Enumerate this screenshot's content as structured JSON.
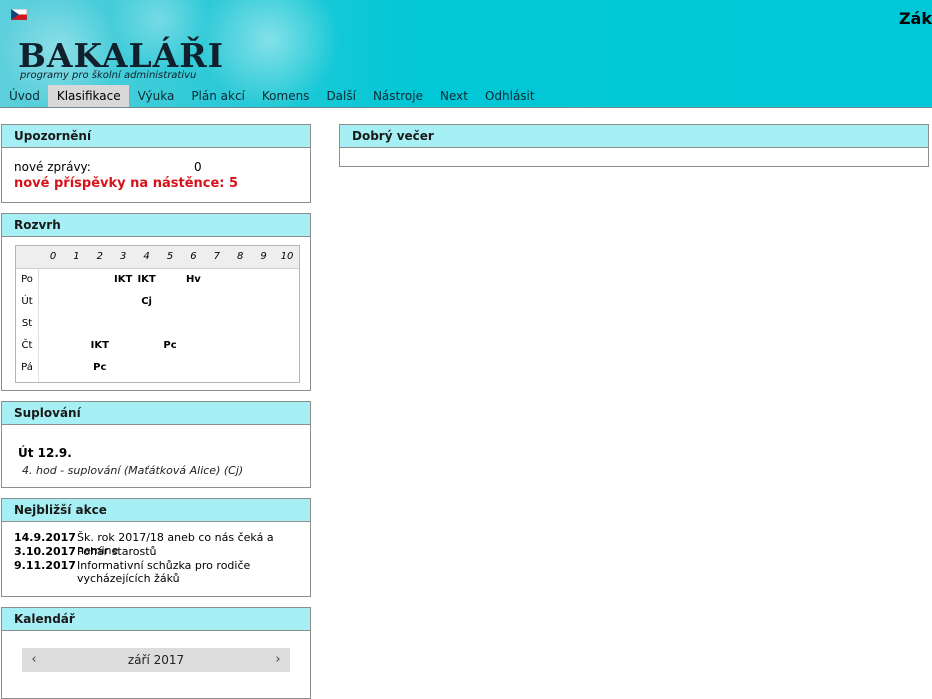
{
  "header": {
    "logo": "BAKALÁŘI",
    "tagline": "programy pro školní administrativu",
    "user_name": "Zák"
  },
  "menu": [
    "Úvod",
    "Klasifikace",
    "Výuka",
    "Plán akcí",
    "Komens",
    "Další",
    "Nástroje",
    "Next",
    "Odhlásit"
  ],
  "alerts": {
    "title": "Upozornění",
    "new_messages_label": "nové zprávy:",
    "new_messages_count": "0",
    "board_label": "nové příspěvky na nástěnce:",
    "board_count": "5"
  },
  "timetable": {
    "title": "Rozvrh",
    "hours": [
      "0",
      "1",
      "2",
      "3",
      "4",
      "5",
      "6",
      "7",
      "8",
      "9",
      "10"
    ],
    "days": [
      {
        "name": "Po",
        "lessons": [
          {
            "hour": 3,
            "subject": "IKT"
          },
          {
            "hour": 4,
            "subject": "IKT"
          },
          {
            "hour": 6,
            "subject": "Hv"
          }
        ]
      },
      {
        "name": "Út",
        "lessons": [
          {
            "hour": 4,
            "subject": "Cj"
          }
        ]
      },
      {
        "name": "St",
        "lessons": []
      },
      {
        "name": "Čt",
        "lessons": [
          {
            "hour": 2,
            "subject": "IKT"
          },
          {
            "hour": 5,
            "subject": "Pc"
          }
        ]
      },
      {
        "name": "Pá",
        "lessons": [
          {
            "hour": 2,
            "subject": "Pc"
          }
        ]
      }
    ]
  },
  "substitutions": {
    "title": "Suplování",
    "day": "Út 12.9.",
    "note": "4. hod - suplování (Maťátková Alice) (Cj)"
  },
  "events": {
    "title": "Nejbližší akce",
    "items": [
      {
        "date": "14.9.2017",
        "text": "Šk. rok 2017/18 aneb co nás čeká a nemine"
      },
      {
        "date": "3.10.2017",
        "text": "Pohár starostů"
      },
      {
        "date": "9.11.2017",
        "text": "Informativní schůzka pro rodiče vycházejících žáků"
      }
    ]
  },
  "calendar": {
    "title": "Kalendář",
    "month": "září 2017",
    "prev": "‹",
    "next": "›"
  },
  "greeting": {
    "title": "Dobrý večer"
  }
}
